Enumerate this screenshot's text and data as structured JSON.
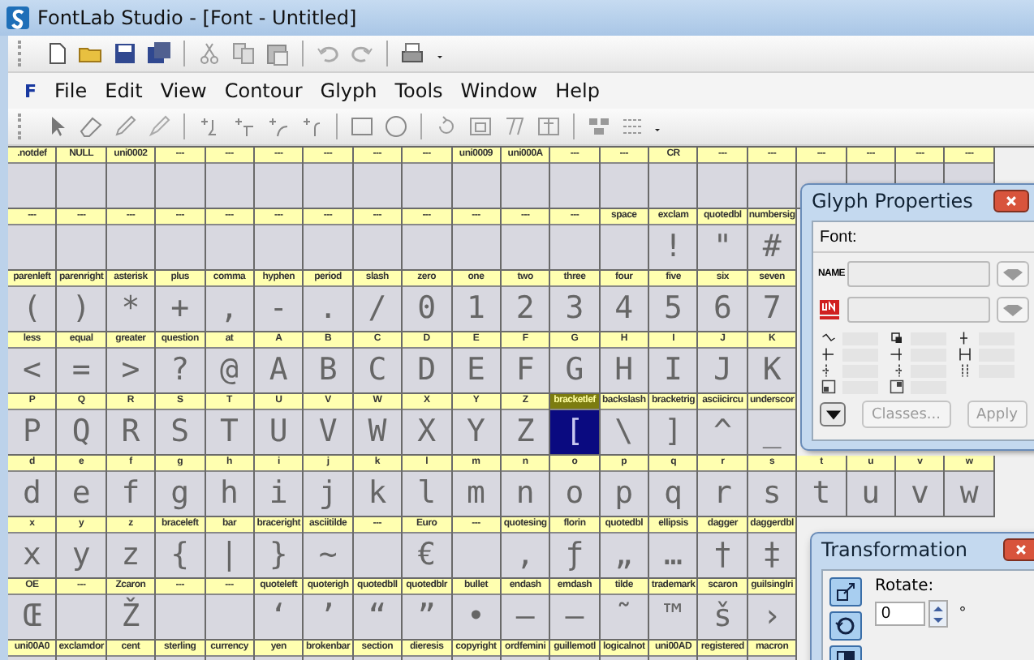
{
  "window": {
    "title": "FontLab Studio - [Font - Untitled]"
  },
  "menu": {
    "logo": "F",
    "items": [
      "File",
      "Edit",
      "View",
      "Contour",
      "Glyph",
      "Tools",
      "Window",
      "Help"
    ]
  },
  "glyph_rows": [
    [
      {
        "name": ".notdef",
        "selected": false
      },
      {
        "name": "NULL",
        "selected": false
      },
      {
        "name": "uni0002",
        "selected": false
      },
      {
        "name": "---",
        "selected": false
      },
      {
        "name": "---",
        "selected": false
      },
      {
        "name": "---",
        "selected": false
      },
      {
        "name": "---",
        "selected": false
      },
      {
        "name": "---",
        "selected": false
      },
      {
        "name": "---",
        "selected": false
      },
      {
        "name": "uni0009",
        "selected": false
      },
      {
        "name": "uni000A",
        "selected": false
      },
      {
        "name": "---",
        "selected": false
      },
      {
        "name": "---",
        "selected": false
      },
      {
        "name": "CR",
        "selected": false
      },
      {
        "name": "---",
        "selected": false
      },
      {
        "name": "---",
        "selected": false
      },
      {
        "name": "---",
        "selected": false
      },
      {
        "name": "---",
        "selected": false
      },
      {
        "name": "---",
        "selected": false
      },
      {
        "name": "---",
        "selected": false
      }
    ],
    [
      {
        "name": "---",
        "selected": false
      },
      {
        "name": "---",
        "selected": false
      },
      {
        "name": "---",
        "selected": false
      },
      {
        "name": "---",
        "selected": false
      },
      {
        "name": "---",
        "selected": false
      },
      {
        "name": "---",
        "selected": false
      },
      {
        "name": "---",
        "selected": false
      },
      {
        "name": "---",
        "selected": false
      },
      {
        "name": "---",
        "selected": false
      },
      {
        "name": "---",
        "selected": false
      },
      {
        "name": "---",
        "selected": false
      },
      {
        "name": "---",
        "selected": false
      },
      {
        "name": "space",
        "selected": false
      },
      {
        "name": "exclam",
        "glyph": "!",
        "selected": false
      },
      {
        "name": "quotedbl",
        "glyph": "\"",
        "selected": false
      },
      {
        "name": "numbersig",
        "glyph": "#",
        "selected": false
      }
    ],
    [
      {
        "name": "parenleft",
        "glyph": "(",
        "selected": false
      },
      {
        "name": "parenright",
        "glyph": ")",
        "selected": false
      },
      {
        "name": "asterisk",
        "glyph": "*",
        "selected": false
      },
      {
        "name": "plus",
        "glyph": "+",
        "selected": false
      },
      {
        "name": "comma",
        "glyph": ",",
        "selected": false
      },
      {
        "name": "hyphen",
        "glyph": "-",
        "selected": false
      },
      {
        "name": "period",
        "glyph": ".",
        "selected": false
      },
      {
        "name": "slash",
        "glyph": "/",
        "selected": false
      },
      {
        "name": "zero",
        "glyph": "0",
        "selected": false
      },
      {
        "name": "one",
        "glyph": "1",
        "selected": false
      },
      {
        "name": "two",
        "glyph": "2",
        "selected": false
      },
      {
        "name": "three",
        "glyph": "3",
        "selected": false
      },
      {
        "name": "four",
        "glyph": "4",
        "selected": false
      },
      {
        "name": "five",
        "glyph": "5",
        "selected": false
      },
      {
        "name": "six",
        "glyph": "6",
        "selected": false
      },
      {
        "name": "seven",
        "glyph": "7",
        "selected": false
      }
    ],
    [
      {
        "name": "less",
        "glyph": "<",
        "selected": false
      },
      {
        "name": "equal",
        "glyph": "=",
        "selected": false
      },
      {
        "name": "greater",
        "glyph": ">",
        "selected": false
      },
      {
        "name": "question",
        "glyph": "?",
        "selected": false
      },
      {
        "name": "at",
        "glyph": "@",
        "selected": false
      },
      {
        "name": "A",
        "glyph": "A",
        "selected": false
      },
      {
        "name": "B",
        "glyph": "B",
        "selected": false
      },
      {
        "name": "C",
        "glyph": "C",
        "selected": false
      },
      {
        "name": "D",
        "glyph": "D",
        "selected": false
      },
      {
        "name": "E",
        "glyph": "E",
        "selected": false
      },
      {
        "name": "F",
        "glyph": "F",
        "selected": false
      },
      {
        "name": "G",
        "glyph": "G",
        "selected": false
      },
      {
        "name": "H",
        "glyph": "H",
        "selected": false
      },
      {
        "name": "I",
        "glyph": "I",
        "selected": false
      },
      {
        "name": "J",
        "glyph": "J",
        "selected": false
      },
      {
        "name": "K",
        "glyph": "K",
        "selected": false
      }
    ],
    [
      {
        "name": "P",
        "glyph": "P",
        "selected": false
      },
      {
        "name": "Q",
        "glyph": "Q",
        "selected": false
      },
      {
        "name": "R",
        "glyph": "R",
        "selected": false
      },
      {
        "name": "S",
        "glyph": "S",
        "selected": false
      },
      {
        "name": "T",
        "glyph": "T",
        "selected": false
      },
      {
        "name": "U",
        "glyph": "U",
        "selected": false
      },
      {
        "name": "V",
        "glyph": "V",
        "selected": false
      },
      {
        "name": "W",
        "glyph": "W",
        "selected": false
      },
      {
        "name": "X",
        "glyph": "X",
        "selected": false
      },
      {
        "name": "Y",
        "glyph": "Y",
        "selected": false
      },
      {
        "name": "Z",
        "glyph": "Z",
        "selected": false
      },
      {
        "name": "bracketlef",
        "glyph": "[",
        "selected": true
      },
      {
        "name": "backslash",
        "glyph": "\\",
        "selected": false
      },
      {
        "name": "bracketrig",
        "glyph": "]",
        "selected": false
      },
      {
        "name": "asciicircu",
        "glyph": "^",
        "selected": false
      },
      {
        "name": "underscor",
        "glyph": "_",
        "selected": false
      }
    ],
    [
      {
        "name": "d",
        "glyph": "d",
        "selected": false
      },
      {
        "name": "e",
        "glyph": "e",
        "selected": false
      },
      {
        "name": "f",
        "glyph": "f",
        "selected": false
      },
      {
        "name": "g",
        "glyph": "g",
        "selected": false
      },
      {
        "name": "h",
        "glyph": "h",
        "selected": false
      },
      {
        "name": "i",
        "glyph": "i",
        "selected": false
      },
      {
        "name": "j",
        "glyph": "j",
        "selected": false
      },
      {
        "name": "k",
        "glyph": "k",
        "selected": false
      },
      {
        "name": "l",
        "glyph": "l",
        "selected": false
      },
      {
        "name": "m",
        "glyph": "m",
        "selected": false
      },
      {
        "name": "n",
        "glyph": "n",
        "selected": false
      },
      {
        "name": "o",
        "glyph": "o",
        "selected": false
      },
      {
        "name": "p",
        "glyph": "p",
        "selected": false
      },
      {
        "name": "q",
        "glyph": "q",
        "selected": false
      },
      {
        "name": "r",
        "glyph": "r",
        "selected": false
      },
      {
        "name": "s",
        "glyph": "s",
        "selected": false
      },
      {
        "name": "t",
        "glyph": "t",
        "selected": false
      },
      {
        "name": "u",
        "glyph": "u",
        "selected": false
      },
      {
        "name": "v",
        "glyph": "v",
        "selected": false
      },
      {
        "name": "w",
        "glyph": "w",
        "selected": false
      }
    ],
    [
      {
        "name": "x",
        "glyph": "x",
        "selected": false
      },
      {
        "name": "y",
        "glyph": "y",
        "selected": false
      },
      {
        "name": "z",
        "glyph": "z",
        "selected": false
      },
      {
        "name": "braceleft",
        "glyph": "{",
        "selected": false
      },
      {
        "name": "bar",
        "glyph": "|",
        "selected": false
      },
      {
        "name": "braceright",
        "glyph": "}",
        "selected": false
      },
      {
        "name": "asciitilde",
        "glyph": "~",
        "selected": false
      },
      {
        "name": "---",
        "selected": false
      },
      {
        "name": "Euro",
        "glyph": "€",
        "selected": false
      },
      {
        "name": "---",
        "selected": false
      },
      {
        "name": "quotesing",
        "glyph": "‚",
        "selected": false
      },
      {
        "name": "florin",
        "glyph": "ƒ",
        "selected": false
      },
      {
        "name": "quotedbl",
        "glyph": "„",
        "selected": false
      },
      {
        "name": "ellipsis",
        "glyph": "…",
        "selected": false
      },
      {
        "name": "dagger",
        "glyph": "†",
        "selected": false
      },
      {
        "name": "daggerdbl",
        "glyph": "‡",
        "selected": false
      }
    ],
    [
      {
        "name": "OE",
        "glyph": "Œ",
        "selected": false
      },
      {
        "name": "---",
        "selected": false
      },
      {
        "name": "Zcaron",
        "glyph": "Ž",
        "selected": false
      },
      {
        "name": "---",
        "selected": false
      },
      {
        "name": "---",
        "selected": false
      },
      {
        "name": "quoteleft",
        "glyph": "‘",
        "selected": false
      },
      {
        "name": "quoterigh",
        "glyph": "’",
        "selected": false
      },
      {
        "name": "quotedbll",
        "glyph": "“",
        "selected": false
      },
      {
        "name": "quotedblr",
        "glyph": "”",
        "selected": false
      },
      {
        "name": "bullet",
        "glyph": "•",
        "selected": false
      },
      {
        "name": "endash",
        "glyph": "–",
        "selected": false
      },
      {
        "name": "emdash",
        "glyph": "—",
        "selected": false
      },
      {
        "name": "tilde",
        "glyph": "˜",
        "selected": false
      },
      {
        "name": "trademark",
        "glyph": "™",
        "selected": false
      },
      {
        "name": "scaron",
        "glyph": "š",
        "selected": false
      },
      {
        "name": "guilsinglri",
        "glyph": "›",
        "selected": false
      }
    ],
    [
      {
        "name": "uni00A0",
        "selected": false
      },
      {
        "name": "exclamdor",
        "selected": false
      },
      {
        "name": "cent",
        "selected": false
      },
      {
        "name": "sterling",
        "selected": false
      },
      {
        "name": "currency",
        "selected": false
      },
      {
        "name": "yen",
        "selected": false
      },
      {
        "name": "brokenbar",
        "selected": false
      },
      {
        "name": "section",
        "selected": false
      },
      {
        "name": "dieresis",
        "selected": false
      },
      {
        "name": "copyright",
        "selected": false
      },
      {
        "name": "ordfemini",
        "selected": false
      },
      {
        "name": "guillemotl",
        "selected": false
      },
      {
        "name": "logicalnot",
        "selected": false
      },
      {
        "name": "uni00AD",
        "selected": false
      },
      {
        "name": "registered",
        "selected": false
      },
      {
        "name": "macron",
        "selected": false
      }
    ]
  ],
  "glyph_properties": {
    "title": "Glyph Properties",
    "font_label": "Font:",
    "name_label": "NAME",
    "buttons": [
      {
        "label": "Classes...",
        "disabled": true
      },
      {
        "label": "Apply",
        "disabled": true
      }
    ]
  },
  "transformation": {
    "title": "Transformation",
    "rotate_label": "Rotate:",
    "rotate_value": "0",
    "unit": "°"
  }
}
